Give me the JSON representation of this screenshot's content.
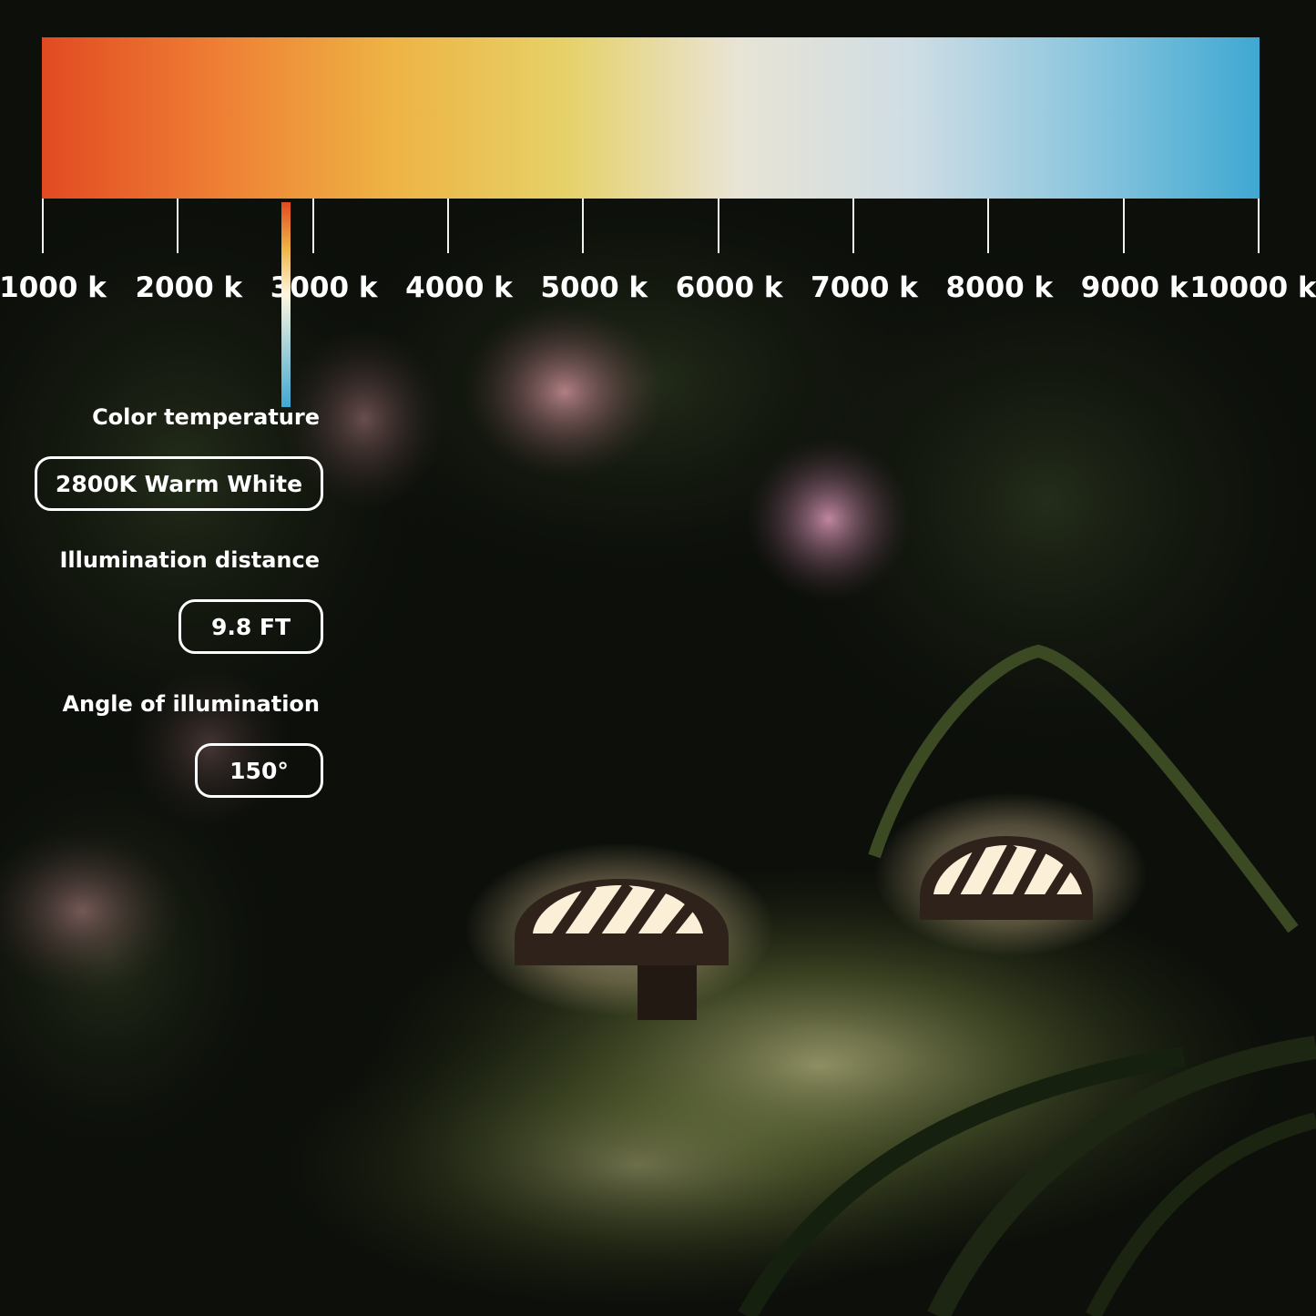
{
  "color_scale": {
    "ticks": [
      "1000 k",
      "2000 k",
      "3000 k",
      "4000 k",
      "5000 k",
      "6000 k",
      "7000 k",
      "8000 k",
      "9000 k",
      "10000 k"
    ],
    "gradient_colors": [
      "#e24a22",
      "#ee7e34",
      "#eeb344",
      "#e6d168",
      "#e8e4d6",
      "#cfdde4",
      "#8cc6de",
      "#3fa8d2"
    ]
  },
  "specs": {
    "color_temperature": {
      "label": "Color temperature",
      "value": "2800K Warm White"
    },
    "illumination_distance": {
      "label": "Illumination distance",
      "value": "9.8 FT"
    },
    "angle": {
      "label": "Angle of illumination",
      "value": "150°"
    }
  }
}
